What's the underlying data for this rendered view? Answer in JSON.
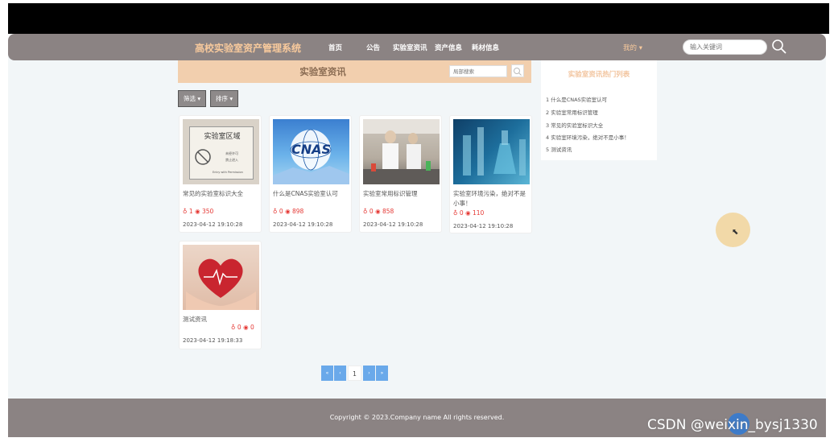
{
  "navbar": {
    "brand": "高校实验室资产管理系统",
    "items": [
      "首页",
      "公告",
      "实验室资讯",
      "资产信息",
      "耗材信息"
    ],
    "user_menu": "我的 ▾",
    "search_placeholder": "输入关键词"
  },
  "title_bar": {
    "title": "实验室资讯",
    "search_placeholder": "局部搜索"
  },
  "filters": {
    "filter_label": "筛选 ▾",
    "sort_label": "排序 ▾"
  },
  "sidebar": {
    "title": "实验室资讯热门列表",
    "items": [
      "1 什么是CNAS实验室认可",
      "2 实验室常用标识管理",
      "3 常见的实验室标识大全",
      "4 实验室环境污染，绝对不是小事！",
      "5 测试资讯"
    ]
  },
  "cards": [
    {
      "title": "常见的实验室标识大全",
      "likes": "1",
      "views": "350",
      "date": "2023-04-12 19:10:28",
      "image": "lab-area-sign"
    },
    {
      "title": "什么是CNAS实验室认可",
      "likes": "0",
      "views": "898",
      "date": "2023-04-12 19:10:28",
      "image": "cnas-logo"
    },
    {
      "title": "实验室常用标识管理",
      "likes": "0",
      "views": "858",
      "date": "2023-04-12 19:10:28",
      "image": "lab-workers"
    },
    {
      "title": "实验室环境污染，绝对不是小事！",
      "likes": "0",
      "views": "110",
      "date": "2023-04-12 19:10:28",
      "image": "lab-flasks"
    },
    {
      "title": "测试资讯",
      "likes": "0",
      "views": "0",
      "date": "2023-04-12 19:18:33",
      "image": "heart-hands"
    }
  ],
  "sign": {
    "heading": "实验室区域",
    "line1": "未经许可",
    "line2": "禁止进入",
    "line3": "Entry with Permission"
  },
  "cnas_text": "CNAS",
  "pagination": {
    "first": "«",
    "prev": "‹",
    "current": "1",
    "next": "›",
    "last": "»"
  },
  "footer": {
    "copyright": "Copyright © 2023.Company name All rights reserved."
  },
  "watermark": "CSDN @weixin_bysj1330",
  "colors": {
    "navbar": "#8b8383",
    "brand": "#f7c99c",
    "title_bar": "#f2cfae",
    "stats": "#e53935",
    "pagination": "#6aa9ea"
  }
}
